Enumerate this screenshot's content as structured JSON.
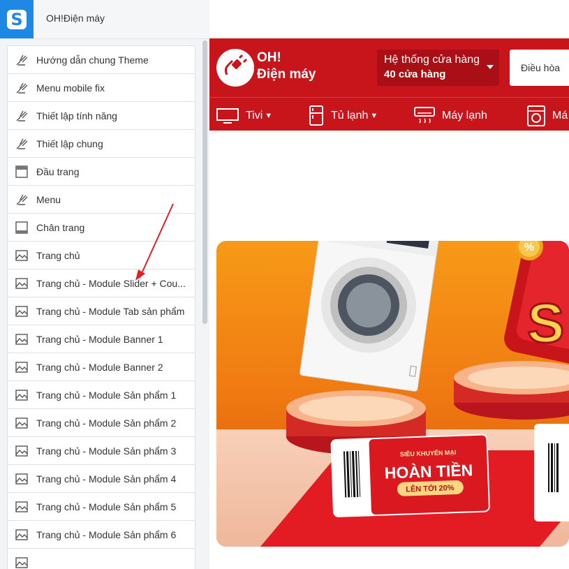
{
  "app": {
    "shop_name": "OH!Điện máy",
    "logo_letter": "S"
  },
  "sidebar": {
    "items": [
      {
        "label": "Hướng dẫn chung Theme",
        "icon": "brush-icon"
      },
      {
        "label": "Menu mobile fix",
        "icon": "brush-icon"
      },
      {
        "label": "Thiết lập tính năng",
        "icon": "brush-icon"
      },
      {
        "label": "Thiết lập chung",
        "icon": "brush-icon"
      },
      {
        "label": "Đầu trang",
        "icon": "header-layout-icon"
      },
      {
        "label": "Menu",
        "icon": "brush-icon"
      },
      {
        "label": "Chân trang",
        "icon": "footer-layout-icon"
      },
      {
        "label": "Trang chủ",
        "icon": "home-page-icon"
      },
      {
        "label": "Trang chủ - Module Slider + Cou...",
        "icon": "home-page-icon"
      },
      {
        "label": "Trang chủ - Module Tab sản phẩm",
        "icon": "home-page-icon"
      },
      {
        "label": "Trang chủ - Module Banner 1",
        "icon": "home-page-icon"
      },
      {
        "label": "Trang chủ - Module Banner 2",
        "icon": "home-page-icon"
      },
      {
        "label": "Trang chủ - Module Sản phẩm 1",
        "icon": "home-page-icon"
      },
      {
        "label": "Trang chủ - Module Sản phẩm 2",
        "icon": "home-page-icon"
      },
      {
        "label": "Trang chủ - Module Sản phẩm 3",
        "icon": "home-page-icon"
      },
      {
        "label": "Trang chủ - Module Sản phẩm 4",
        "icon": "home-page-icon"
      },
      {
        "label": "Trang chủ - Module Sản phẩm 5",
        "icon": "home-page-icon"
      },
      {
        "label": "Trang chủ - Module Sản phẩm 6",
        "icon": "home-page-icon"
      },
      {
        "label": "",
        "icon": "home-page-icon"
      }
    ]
  },
  "preview": {
    "brand_line1": "OH!",
    "brand_line2": "Điện máy",
    "store_line1": "Hệ thống cửa hàng",
    "store_line2": "40 cửa hàng",
    "search_text": "Điều hòa",
    "categories": [
      {
        "label": "Tivi",
        "icon": "tv-icon"
      },
      {
        "label": "Tủ lạnh",
        "icon": "fridge-icon"
      },
      {
        "label": "Máy lạnh",
        "icon": "air-conditioner-icon"
      },
      {
        "label": "Má",
        "icon": "washing-machine-icon"
      }
    ],
    "banner": {
      "ticket_top": "SIÊU KHUYẾN MẠI",
      "ticket_main": "HOÀN TIỀN",
      "ticket_sub": "LÊN TỚI 20%",
      "percent_symbol": "%",
      "sale_letter": "S"
    }
  },
  "colors": {
    "brand_red": "#c8141b",
    "editor_blue": "#1e88e5"
  }
}
